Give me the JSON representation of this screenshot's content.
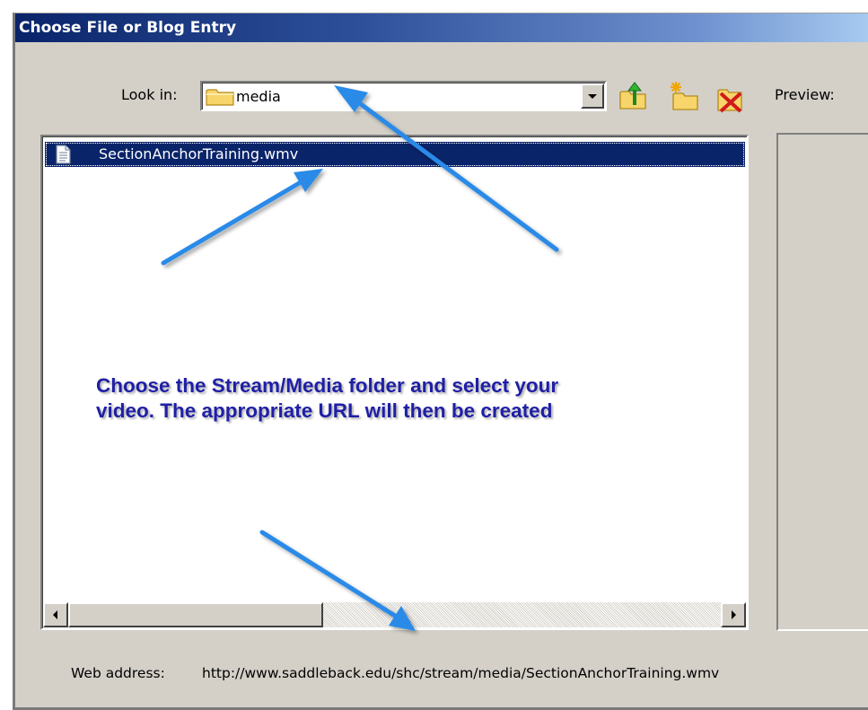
{
  "dialog": {
    "title": "Choose File or Blog Entry"
  },
  "lookin": {
    "label": "Look in:",
    "value": "media"
  },
  "toolbar": {
    "buttons": [
      "up-one-level-icon",
      "new-folder-icon",
      "delete-icon"
    ]
  },
  "preview": {
    "label": "Preview:"
  },
  "files": [
    {
      "name": "SectionAnchorTraining.wmv",
      "selected": true
    }
  ],
  "webaddress": {
    "label": "Web address:",
    "value": "http://www.saddleback.edu/shc/stream/media/SectionAnchorTraining.wmv"
  },
  "annotation": {
    "lines": [
      "Choose the Stream/Media folder and select your",
      "video.  The appropriate URL will then be created"
    ],
    "color": "#1f1fa6",
    "arrow_color": "#2a8ae8"
  },
  "colors": {
    "selection": "#0a246a",
    "dialog_bg": "#d4d0c8",
    "title_start": "#0a246a",
    "title_end": "#a6caf0"
  }
}
